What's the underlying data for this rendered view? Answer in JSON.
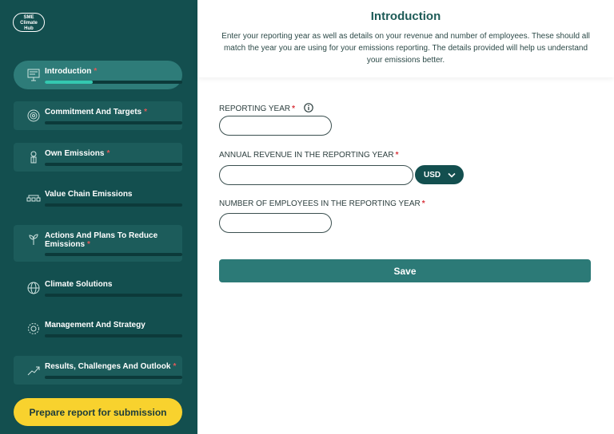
{
  "logo": {
    "line1": "SME",
    "line2": "Climate",
    "line3": "Hub"
  },
  "sidebar": {
    "items": [
      {
        "label": "Introduction",
        "required": "*",
        "progress": 0.35
      },
      {
        "label": "Commitment And Targets",
        "required": "*",
        "progress": 0
      },
      {
        "label": "Own Emissions",
        "required": "*",
        "progress": 0
      },
      {
        "label": "Value Chain Emissions",
        "required": "",
        "progress": 0
      },
      {
        "label": "Actions And Plans To Reduce Emissions",
        "required": "*",
        "progress": 0
      },
      {
        "label": "Climate Solutions",
        "required": "",
        "progress": 0
      },
      {
        "label": "Management And Strategy",
        "required": "",
        "progress": 0
      },
      {
        "label": "Results, Challenges And Outlook",
        "required": "*",
        "progress": 0
      }
    ],
    "submit_label": "Prepare report for submission"
  },
  "header": {
    "title": "Introduction",
    "description": "Enter your reporting year as well as details on your revenue and number of employees. These should all match the year you are using for your emissions reporting. The details provided will help us understand your emissions better."
  },
  "form": {
    "reporting_year": {
      "label": "REPORTING YEAR",
      "required": "*",
      "value": ""
    },
    "annual_revenue": {
      "label": "ANNUAL REVENUE IN THE REPORTING YEAR",
      "required": "*",
      "value": "",
      "currency": "USD"
    },
    "employees": {
      "label": "NUMBER OF EMPLOYEES IN THE REPORTING YEAR",
      "required": "*",
      "value": ""
    },
    "save_label": "Save"
  },
  "colors": {
    "sidebar_bg": "#134f4f",
    "accent": "#2c7a77",
    "progress": "#34c8b0",
    "submit": "#f8d22e",
    "required": "#d9363e"
  }
}
